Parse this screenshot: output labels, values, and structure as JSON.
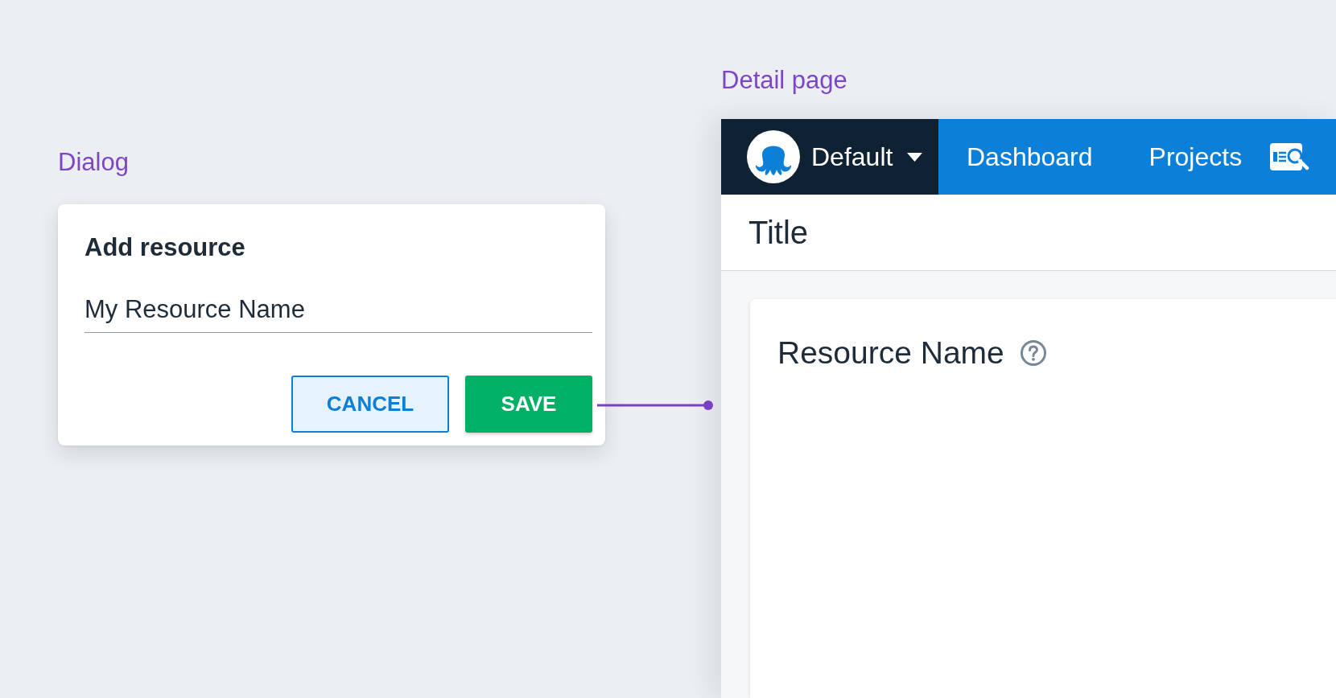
{
  "dialog_section": {
    "label": "Dialog"
  },
  "dialog": {
    "title": "Add resource",
    "name_field": {
      "value": "My Resource Name"
    },
    "buttons": [
      {
        "label": "CANCEL",
        "kind": "secondary"
      },
      {
        "label": "SAVE",
        "kind": "primary"
      }
    ]
  },
  "detail_section": {
    "label": "Detail page"
  },
  "detail_page": {
    "nav": {
      "space": "Default",
      "links": [
        {
          "label": "Dashboard"
        },
        {
          "label": "Projects"
        }
      ]
    },
    "title": "Title",
    "card": {
      "heading": "Resource Name"
    }
  }
}
